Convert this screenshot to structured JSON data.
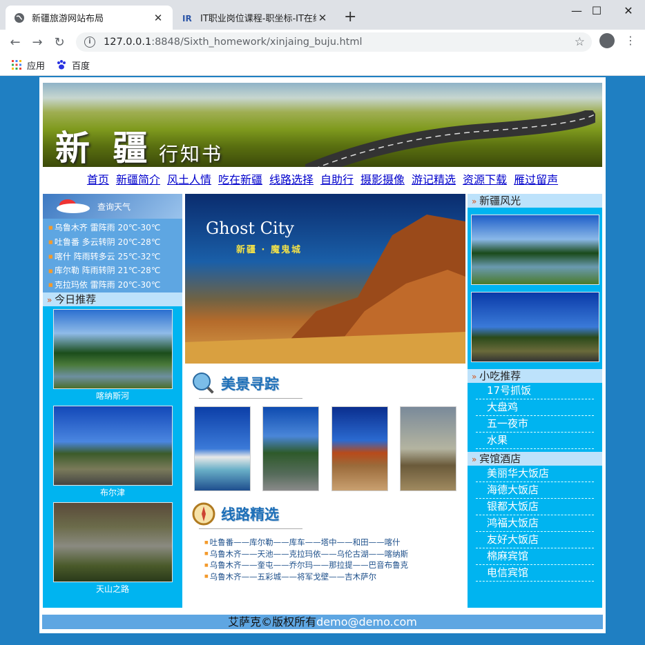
{
  "browser": {
    "tabs": [
      {
        "title": "新疆旅游网站布局",
        "active": true
      },
      {
        "title": "IT职业岗位课程-职坐标-IT在线学",
        "active": false
      }
    ],
    "url_host": "127.0.0.1",
    "url_rest": ":8848/Sixth_homework/xinjaing_buju.html",
    "bookmarks": [
      {
        "label": "应用",
        "icon": "apps-grid-icon"
      },
      {
        "label": "百度",
        "icon": "baidu-paw-icon"
      }
    ]
  },
  "banner": {
    "title": "新 疆",
    "subtitle": "行知书"
  },
  "nav": [
    "首页",
    "新疆简介",
    "风土人情",
    "吃在新疆",
    "线路选择",
    "自助行",
    "摄影摄像",
    "游记精选",
    "资源下载",
    "雁过留声"
  ],
  "weather": {
    "title": "查询天气",
    "items": [
      "乌鲁木齐 雷阵雨 20℃-30℃",
      "吐鲁番 多云转阴 20℃-28℃",
      "喀什 阵雨转多云 25℃-32℃",
      "库尔勒 阵雨转阴 21℃-28℃",
      "克拉玛依 雷阵雨 20℃-30℃"
    ]
  },
  "today": {
    "title": "今日推荐",
    "items": [
      "喀纳斯河",
      "布尔津",
      "天山之路"
    ]
  },
  "hero": {
    "title": "Ghost City",
    "subtitle": "新疆 · 魔鬼城"
  },
  "scenic": {
    "title": "美景寻踪"
  },
  "routes": {
    "title": "线路精选",
    "items": [
      "吐鲁番——库尔勒——库车——塔中——和田——喀什",
      "乌鲁木齐——天池——克拉玛依——乌伦古湖——喀纳斯",
      "乌鲁木齐——奎屯——乔尔玛——那拉提——巴音布鲁克",
      "乌鲁木齐——五彩城——将军戈壁——吉木萨尔"
    ]
  },
  "scenery": {
    "title": "新疆风光"
  },
  "snacks": {
    "title": "小吃推荐",
    "items": [
      "17号抓饭",
      "大盘鸡",
      "五一夜市",
      "水果"
    ]
  },
  "hotels": {
    "title": "宾馆酒店",
    "items": [
      "美丽华大饭店",
      "海德大饭店",
      "银都大饭店",
      "鸿福大饭店",
      "友好大饭店",
      "棉麻宾馆",
      "电信宾馆"
    ]
  },
  "footer": {
    "text": "艾萨克©版权所有",
    "email": "demo@demo.com"
  },
  "colors": {
    "side_bg": "#00b4f0",
    "weather_bg": "#5ea6e2",
    "page_bg": "#1f7fc2",
    "link": "#0000cc"
  }
}
